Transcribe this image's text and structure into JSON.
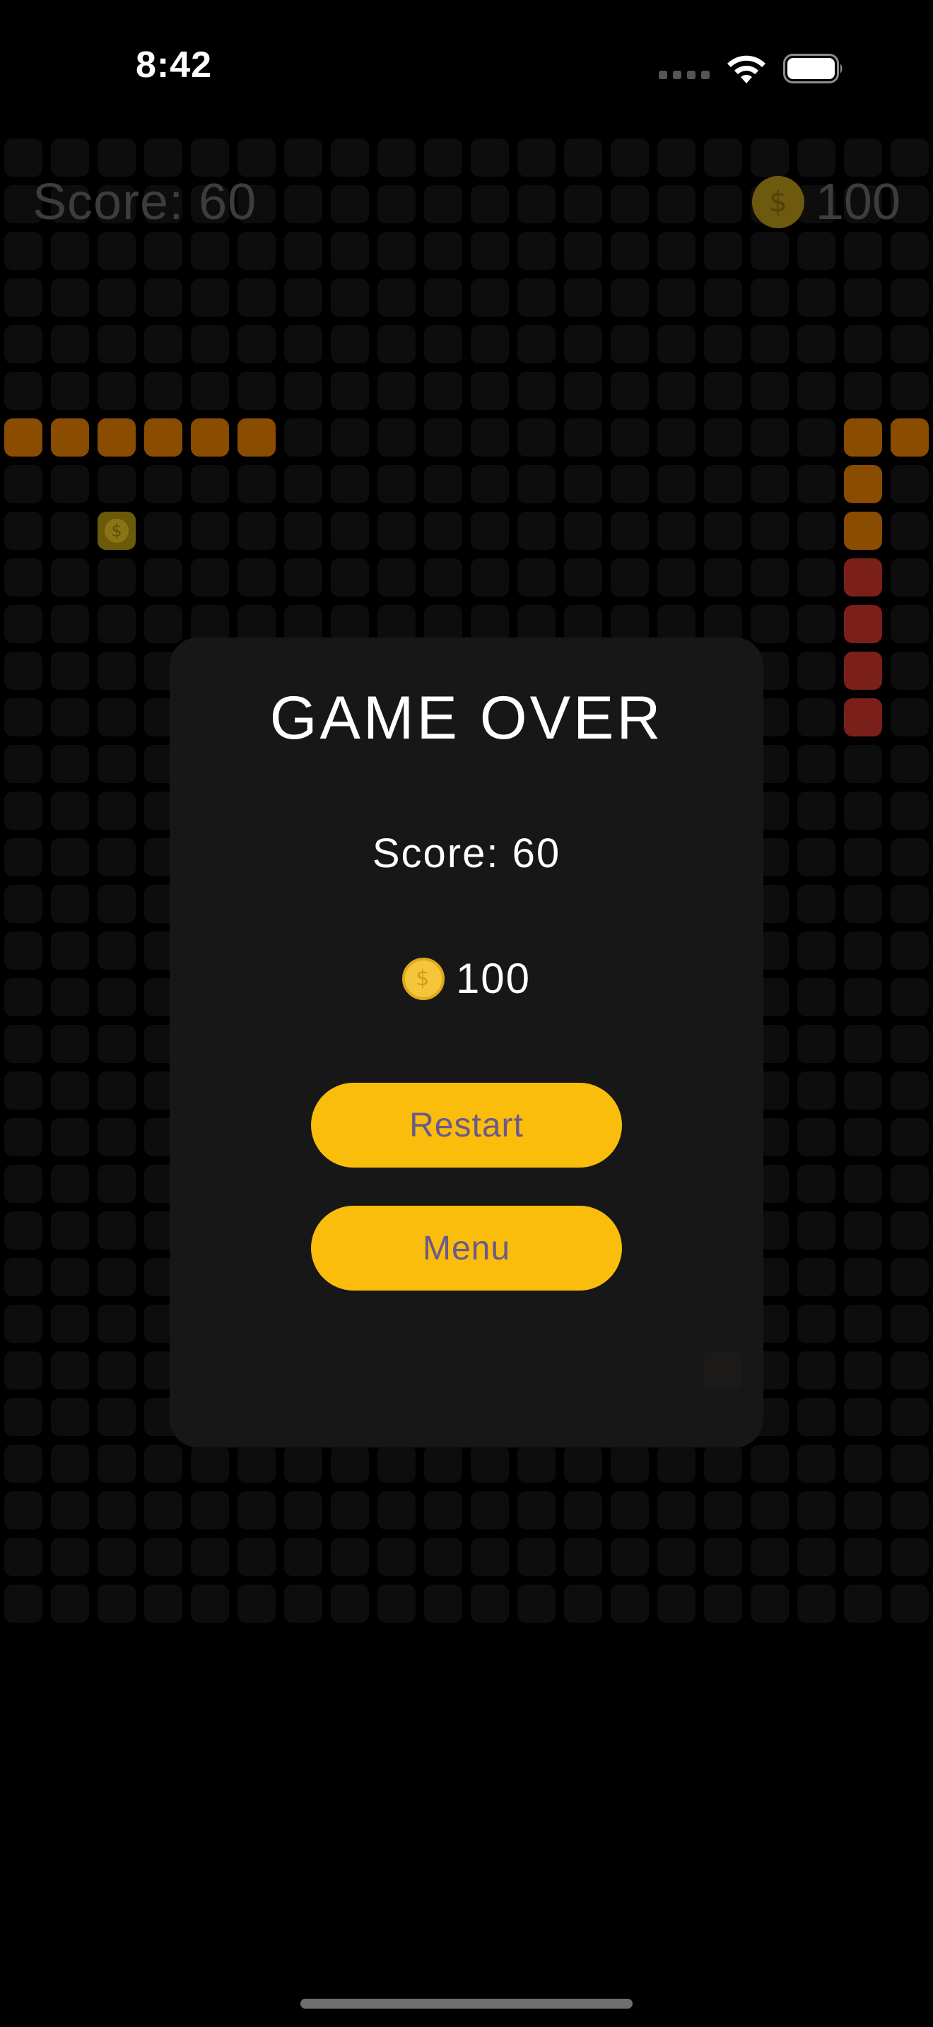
{
  "status_bar": {
    "time": "8:42"
  },
  "hud": {
    "score_text": "Score: 60",
    "coins_text": "100",
    "coin_symbol": "$"
  },
  "game_over": {
    "title": "GAME OVER",
    "score_text": "Score: 60",
    "coins_text": "100",
    "coin_symbol": "$",
    "restart_label": "Restart",
    "menu_label": "Menu"
  },
  "board": {
    "columns": 20,
    "rows": 32
  },
  "snake": [
    {
      "col": 18,
      "row": 6,
      "color": "orange"
    },
    {
      "col": 19,
      "row": 6,
      "color": "orange"
    },
    {
      "col": 18,
      "row": 7,
      "color": "orange"
    },
    {
      "col": 18,
      "row": 8,
      "color": "orange"
    },
    {
      "col": 18,
      "row": 9,
      "color": "red"
    },
    {
      "col": 18,
      "row": 10,
      "color": "red"
    },
    {
      "col": 18,
      "row": 11,
      "color": "red"
    },
    {
      "col": 18,
      "row": 12,
      "color": "red"
    },
    {
      "col": 0,
      "row": 6,
      "color": "orange"
    },
    {
      "col": 1,
      "row": 6,
      "color": "orange"
    },
    {
      "col": 2,
      "row": 6,
      "color": "orange"
    },
    {
      "col": 3,
      "row": 6,
      "color": "orange"
    },
    {
      "col": 4,
      "row": 6,
      "color": "orange"
    },
    {
      "col": 5,
      "row": 6,
      "color": "orange"
    }
  ],
  "food": [
    {
      "col": 2,
      "row": 8,
      "type": "coin"
    },
    {
      "col": 15,
      "row": 26,
      "type": "brown"
    }
  ],
  "colors": {
    "background": "#000000",
    "cell": "#0d0d0d",
    "snake_orange": "#8a4c00",
    "snake_red": "#7a1f1a",
    "button": "#fbbd0b",
    "button_text": "#6a5a8c",
    "coin": "#f5c63b"
  }
}
